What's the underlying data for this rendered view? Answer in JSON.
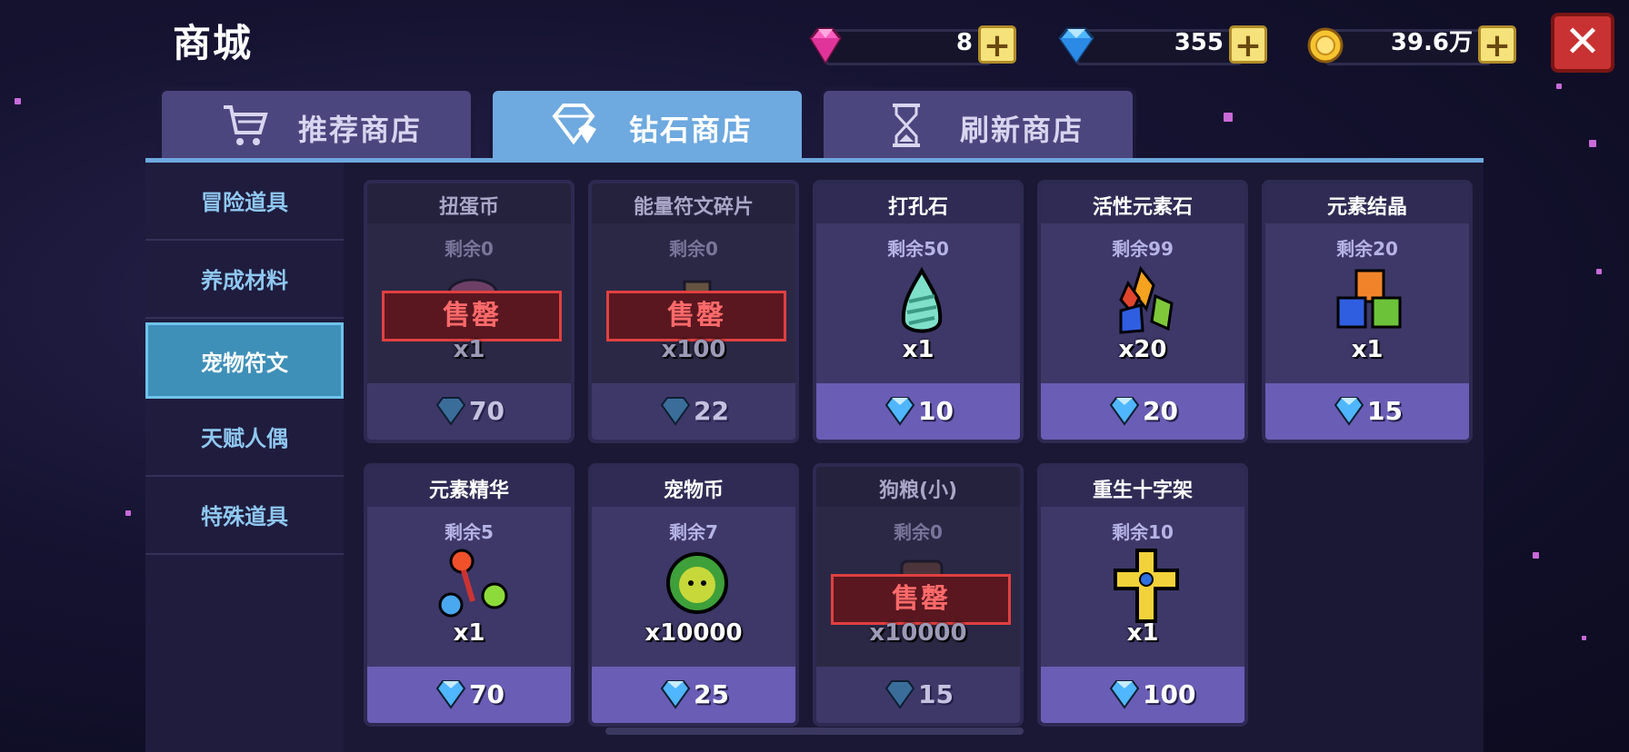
{
  "title": "商城",
  "currencies": [
    {
      "name": "pink-gem",
      "value": "8"
    },
    {
      "name": "blue-diamond",
      "value": "355"
    },
    {
      "name": "gold-coin",
      "value": "39.6万"
    }
  ],
  "plus_label": "+",
  "close_label": "✕",
  "tabs": [
    {
      "label": "推荐商店",
      "icon": "cart-icon",
      "active": false
    },
    {
      "label": "钻石商店",
      "icon": "diamond-icon",
      "active": true
    },
    {
      "label": "刷新商店",
      "icon": "hourglass-icon",
      "active": false
    }
  ],
  "sidebar": [
    {
      "label": "冒险道具"
    },
    {
      "label": "养成材料"
    },
    {
      "label": "宠物符文",
      "active": true
    },
    {
      "label": "天赋人偶"
    },
    {
      "label": "特殊道具"
    }
  ],
  "sold_label": "售罄",
  "items": [
    {
      "name": "扭蛋币",
      "remaining": "剩余0",
      "qty": "x1",
      "price": "70",
      "sold_out": true,
      "icon": "capsule-coin-icon"
    },
    {
      "name": "能量符文碎片",
      "remaining": "剩余0",
      "qty": "x100",
      "price": "22",
      "sold_out": true,
      "icon": "rune-shard-icon"
    },
    {
      "name": "打孔石",
      "remaining": "剩余50",
      "qty": "x1",
      "price": "10",
      "sold_out": false,
      "icon": "drill-stone-icon"
    },
    {
      "name": "活性元素石",
      "remaining": "剩余99",
      "qty": "x20",
      "price": "20",
      "sold_out": false,
      "icon": "element-stone-icon"
    },
    {
      "name": "元素结晶",
      "remaining": "剩余20",
      "qty": "x1",
      "price": "15",
      "sold_out": false,
      "icon": "element-crystal-icon"
    },
    {
      "name": "元素精华",
      "remaining": "剩余5",
      "qty": "x1",
      "price": "70",
      "sold_out": false,
      "icon": "element-essence-icon"
    },
    {
      "name": "宠物币",
      "remaining": "剩余7",
      "qty": "x10000",
      "price": "25",
      "sold_out": false,
      "icon": "pet-coin-icon"
    },
    {
      "name": "狗粮(小)",
      "remaining": "剩余0",
      "qty": "x10000",
      "price": "15",
      "sold_out": true,
      "icon": "dog-food-icon"
    },
    {
      "name": "重生十字架",
      "remaining": "剩余10",
      "qty": "x1",
      "price": "100",
      "sold_out": false,
      "icon": "rebirth-cross-icon"
    }
  ]
}
